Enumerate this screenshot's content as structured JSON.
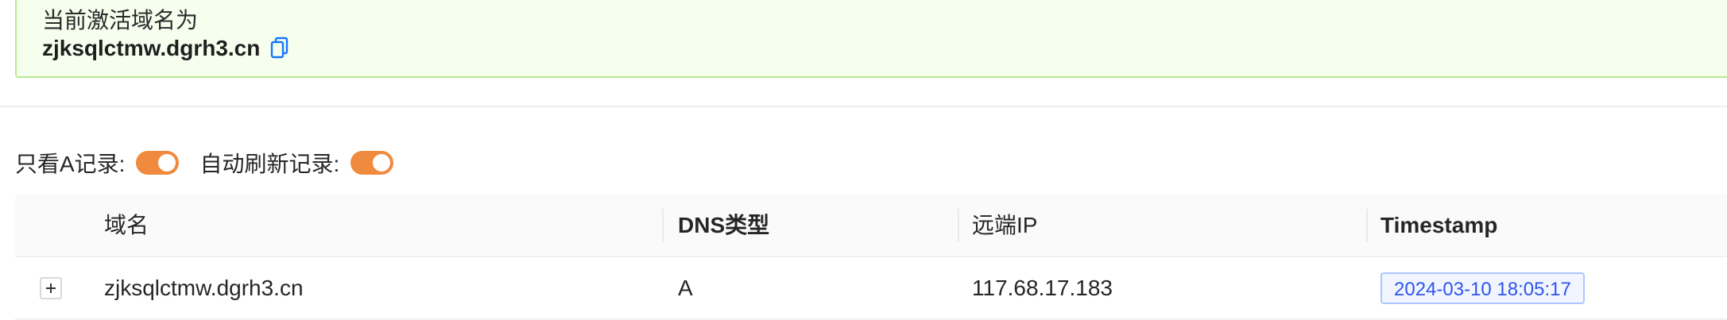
{
  "alert": {
    "title": "当前激活域名为",
    "domain": "zjksqlctmw.dgrh3.cn",
    "copy_icon": "copy-icon"
  },
  "filters": {
    "only_a_label": "只看A记录:",
    "only_a_on": true,
    "auto_refresh_label": "自动刷新记录:",
    "auto_refresh_on": true
  },
  "table": {
    "columns": [
      "域名",
      "DNS类型",
      "远端IP",
      "Timestamp"
    ],
    "rows": [
      {
        "domain": "zjksqlctmw.dgrh3.cn",
        "type": "A",
        "ip": "117.68.17.183",
        "timestamp": "2024-03-10 18:05:17"
      }
    ]
  },
  "colors": {
    "alert_bg": "#f6ffed",
    "alert_border": "#b7eb8f",
    "switch_on": "#f08a3e",
    "tag_text": "#2f54eb",
    "tag_border": "#adc6ff",
    "copy_icon": "#1677ff"
  }
}
